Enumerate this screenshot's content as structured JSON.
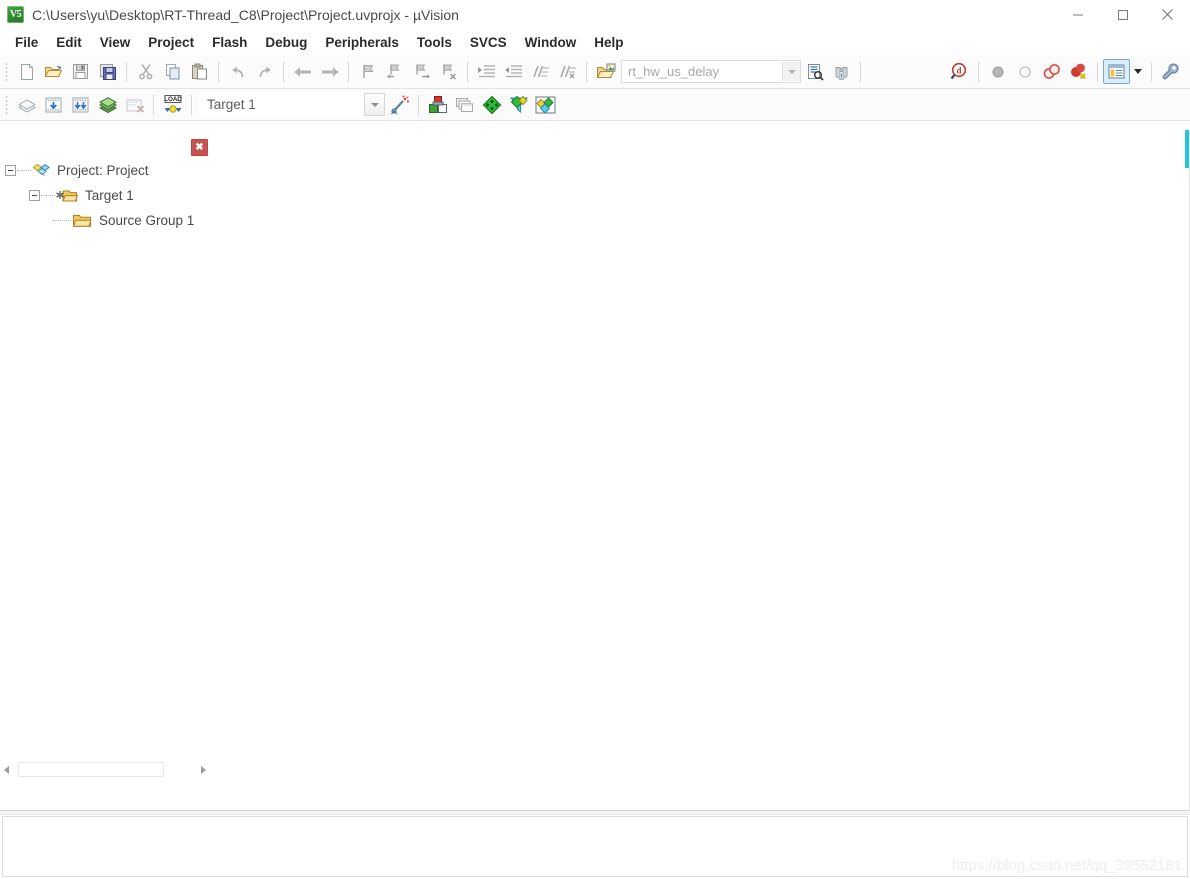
{
  "window": {
    "title": "C:\\Users\\yu\\Desktop\\RT-Thread_C8\\Project\\Project.uvprojx - µVision",
    "app_icon_text": "V5",
    "controls": {
      "minimize": "minimize-icon",
      "maximize": "maximize-icon",
      "close": "close-icon"
    }
  },
  "menubar": {
    "items": [
      {
        "label": "File"
      },
      {
        "label": "Edit"
      },
      {
        "label": "View"
      },
      {
        "label": "Project"
      },
      {
        "label": "Flash"
      },
      {
        "label": "Debug"
      },
      {
        "label": "Peripherals"
      },
      {
        "label": "Tools"
      },
      {
        "label": "SVCS"
      },
      {
        "label": "Window"
      },
      {
        "label": "Help"
      }
    ]
  },
  "toolbar_main": {
    "buttons": [
      {
        "name": "new-file-button",
        "icon": "new-file-icon",
        "tip": "New"
      },
      {
        "name": "open-file-button",
        "icon": "open-folder-icon",
        "tip": "Open"
      },
      {
        "name": "save-button",
        "icon": "save-disk-icon",
        "tip": "Save"
      },
      {
        "name": "save-all-button",
        "icon": "save-all-icon",
        "tip": "Save All"
      },
      {
        "name": "cut-button",
        "icon": "scissors-icon",
        "tip": "Cut"
      },
      {
        "name": "copy-button",
        "icon": "copy-icon",
        "tip": "Copy"
      },
      {
        "name": "paste-button",
        "icon": "paste-icon",
        "tip": "Paste"
      },
      {
        "name": "undo-button",
        "icon": "undo-arrow-icon",
        "tip": "Undo"
      },
      {
        "name": "redo-button",
        "icon": "redo-arrow-icon",
        "tip": "Redo"
      },
      {
        "name": "navigate-back-button",
        "icon": "arrow-left-icon",
        "tip": "Back"
      },
      {
        "name": "navigate-forward-button",
        "icon": "arrow-right-icon",
        "tip": "Forward"
      },
      {
        "name": "bookmark-toggle-button",
        "icon": "bookmark-icon",
        "tip": "Insert/Remove Bookmark"
      },
      {
        "name": "bookmark-prev-button",
        "icon": "bookmark-prev-icon",
        "tip": "Previous Bookmark"
      },
      {
        "name": "bookmark-next-button",
        "icon": "bookmark-next-icon",
        "tip": "Next Bookmark"
      },
      {
        "name": "bookmark-clear-button",
        "icon": "bookmark-clear-icon",
        "tip": "Clear All Bookmarks"
      },
      {
        "name": "indent-button",
        "icon": "indent-right-icon",
        "tip": "Indent"
      },
      {
        "name": "outdent-button",
        "icon": "indent-left-icon",
        "tip": "Outdent"
      },
      {
        "name": "comment-button",
        "icon": "comment-lines-icon",
        "tip": "Comment"
      },
      {
        "name": "uncomment-button",
        "icon": "uncomment-lines-icon",
        "tip": "Uncomment"
      },
      {
        "name": "open-file-in-project-button",
        "icon": "open-file-folder-icon",
        "tip": "Open File"
      }
    ],
    "search": {
      "value": "rt_hw_us_delay",
      "name": "find-in-files-input"
    },
    "after_search_buttons": [
      {
        "name": "find-in-files-button",
        "icon": "find-in-files-icon",
        "tip": "Find in Files"
      },
      {
        "name": "browse-symbol-button",
        "icon": "binoculars-icon",
        "tip": "Browse Symbol"
      }
    ],
    "right_buttons": [
      {
        "name": "debug-symbol-browse-button",
        "icon": "magnifier-d-icon",
        "tip": "Symbol Window"
      },
      {
        "name": "breakpoint-disabled-button",
        "icon": "gray-circle-icon",
        "tip": "Insert/Remove Breakpoint"
      },
      {
        "name": "breakpoint-empty-button",
        "icon": "hollow-circle-icon",
        "tip": "Enable/Disable Breakpoint"
      },
      {
        "name": "breakpoints-disable-all-button",
        "icon": "two-red-circles-icon",
        "tip": "Disable All Breakpoints"
      },
      {
        "name": "breakpoints-kill-all-button",
        "icon": "red-circles-x-icon",
        "tip": "Kill All Breakpoints"
      },
      {
        "name": "window-layout-button",
        "icon": "window-panes-icon",
        "tip": "Manage Window Layout",
        "selected": true
      },
      {
        "name": "configure-button",
        "icon": "wrench-icon",
        "tip": "Configuration"
      }
    ]
  },
  "toolbar_build": {
    "buttons": [
      {
        "name": "translate-file-button",
        "icon": "translate-file-icon",
        "tip": "Translate"
      },
      {
        "name": "build-button",
        "icon": "build-target-icon",
        "tip": "Build"
      },
      {
        "name": "rebuild-button",
        "icon": "rebuild-all-icon",
        "tip": "Rebuild"
      },
      {
        "name": "batch-build-button",
        "icon": "batch-build-icon",
        "tip": "Batch Build"
      },
      {
        "name": "stop-build-button",
        "icon": "stop-build-icon",
        "tip": "Stop Build"
      },
      {
        "name": "download-button",
        "icon": "load-download-icon",
        "tip": "Download"
      }
    ],
    "target_select": {
      "name": "target-selector",
      "value": "Target 1"
    },
    "right_buttons": [
      {
        "name": "target-options-wizard-button",
        "icon": "magic-wand-icon",
        "tip": "Configuration Wizard"
      },
      {
        "name": "options-for-target-button",
        "icon": "target-options-icon",
        "tip": "Options for Target"
      },
      {
        "name": "manage-multi-project-button",
        "icon": "multi-project-icon",
        "tip": "Manage Multi-Project"
      },
      {
        "name": "pack-installer-button",
        "icon": "green-diamond-icon",
        "tip": "Pack Installer"
      },
      {
        "name": "manage-run-time-button",
        "icon": "run-time-env-icon",
        "tip": "Manage Run-Time Environment"
      },
      {
        "name": "select-software-packs-button",
        "icon": "software-packs-icon",
        "tip": "Select Software Packs"
      }
    ]
  },
  "project_pane": {
    "close_button_label": "✖",
    "tree": [
      {
        "label": "Project: Project",
        "icon": "project-icon",
        "level": 0,
        "expanded": true
      },
      {
        "label": "Target 1",
        "icon": "target-folder-icon",
        "level": 1,
        "expanded": true
      },
      {
        "label": "Source Group 1",
        "icon": "folder-icon",
        "level": 2,
        "expanded": false
      }
    ]
  },
  "scrollbars": {
    "horizontal": {
      "left_arrow": "scroll-left-arrow",
      "right_arrow": "scroll-right-arrow"
    }
  },
  "colors": {
    "accent_cyan": "#25c3dd",
    "close_red": "#c75450",
    "selected_blue": "#dbeefb",
    "title_text": "#4a4a4a"
  },
  "watermark": {
    "text": "https://blog.csdn.net/qq_39552181"
  }
}
